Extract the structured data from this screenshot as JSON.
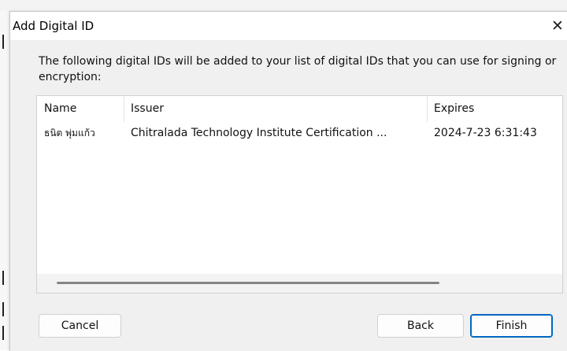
{
  "dialog": {
    "title": "Add Digital ID",
    "close_glyph": "✕",
    "intro_text": "The following digital IDs will be added to your list of digital IDs that you can use for signing or encryption:"
  },
  "list": {
    "columns": [
      "Name",
      "Issuer",
      "Expires"
    ],
    "rows": [
      {
        "name": "ธนิต พุ่มแก้ว",
        "issuer": "Chitralada Technology Institute Certification ...",
        "expires": "2024-7-23 6:31:43"
      }
    ]
  },
  "buttons": {
    "cancel": "Cancel",
    "back": "Back",
    "finish": "Finish"
  },
  "colors": {
    "accent": "#0067c0",
    "dialog_bg": "#f0f0f0"
  }
}
